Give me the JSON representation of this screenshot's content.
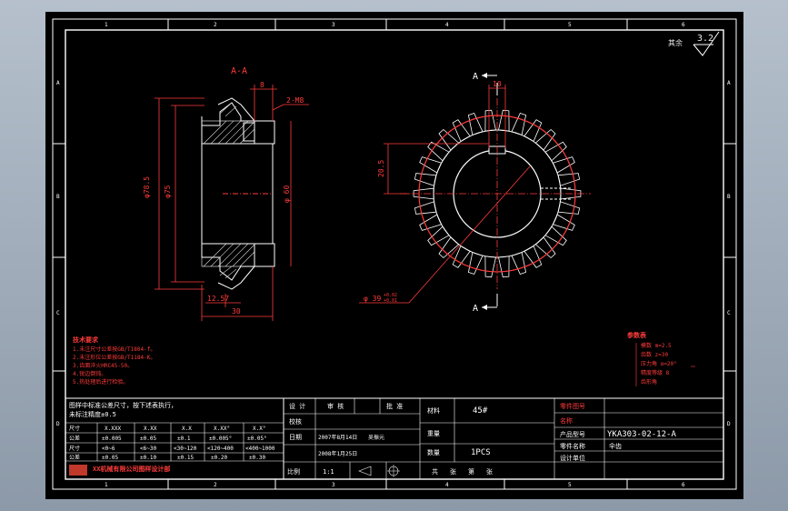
{
  "zones": {
    "top": [
      "1",
      "2",
      "3",
      "4",
      "5",
      "6"
    ],
    "bottom": [
      "1",
      "2",
      "3",
      "4",
      "5",
      "6"
    ],
    "left": [
      "A",
      "B",
      "C",
      "D"
    ],
    "right": [
      "A",
      "B",
      "C",
      "D"
    ]
  },
  "roughness": {
    "prefix": "其余",
    "value": "3.2"
  },
  "section_view": {
    "title": "A-A",
    "dims": {
      "d_outer": "φ78.5",
      "d_mid": "φ75",
      "d_bore": "φ 60",
      "width_top": "8",
      "chamfer": "2-M8",
      "face": "12.57",
      "length": "30"
    }
  },
  "front_view": {
    "section_mark_top": "A",
    "section_mark_bottom": "A",
    "dim_keyway_width": "10",
    "dim_height": "20.5",
    "dim_bore": "φ 39",
    "tol_upper": "+0.02",
    "tol_lower": "+0.01"
  },
  "tech_requirements": {
    "title": "技术要求",
    "lines": [
      "1.未注尺寸公差按GB/T1804-f。",
      "2.未注形位公差按GB/T1184-K。",
      "3.齿面淬火HRC45-50。",
      "4.锐边倒钝。",
      "5.热处理后进行检验。"
    ]
  },
  "gear_params": {
    "title": "参数表",
    "lines": [
      "模数 m=2.5",
      "齿数 z=30",
      "压力角 α=20°",
      "精度等级 8",
      "齿形角"
    ]
  },
  "tolerance_table": {
    "header_note": "图样中标准公差尺寸，按下述表执行，",
    "header_note2": "未标注精度±0.5",
    "cols": [
      "尺寸",
      "X.XXX",
      "X.XX",
      "X.X",
      "X.XX°",
      "X.X°"
    ],
    "rows": [
      [
        "公差",
        "±0.005",
        "±0.05",
        "±0.1",
        "±0.005°",
        "±0.05°"
      ],
      [
        "尺寸",
        "<0~6",
        "<6~30",
        "<30~120",
        "<120~400",
        "<400~1000"
      ],
      [
        "公差",
        "±0.05",
        "±0.10",
        "±0.15",
        "±0.20",
        "±0.30"
      ]
    ],
    "company": "XX机械有限公司图样设计部"
  },
  "title_block": {
    "design": "设 计",
    "review": "审 核",
    "approve": "批 准",
    "check": "校核",
    "date_label": "日期",
    "designer_date": "2007年8月14日",
    "designer_name": "吴振元",
    "draw_date": "2008年1月25日",
    "material_label": "材料",
    "material": "45#",
    "weight_label": "重量",
    "qty_label": "数量",
    "qty": "1PCS",
    "scale_label": "比例",
    "scale": "1:1",
    "sheet_labels": [
      "共",
      "张",
      "第",
      "张"
    ],
    "right_labels": [
      "零件图号",
      "名称",
      "产品型号",
      "零件名称",
      "设计单位"
    ],
    "drawing_no": "YKA303-02-12-A",
    "part_name": "伞齿"
  }
}
